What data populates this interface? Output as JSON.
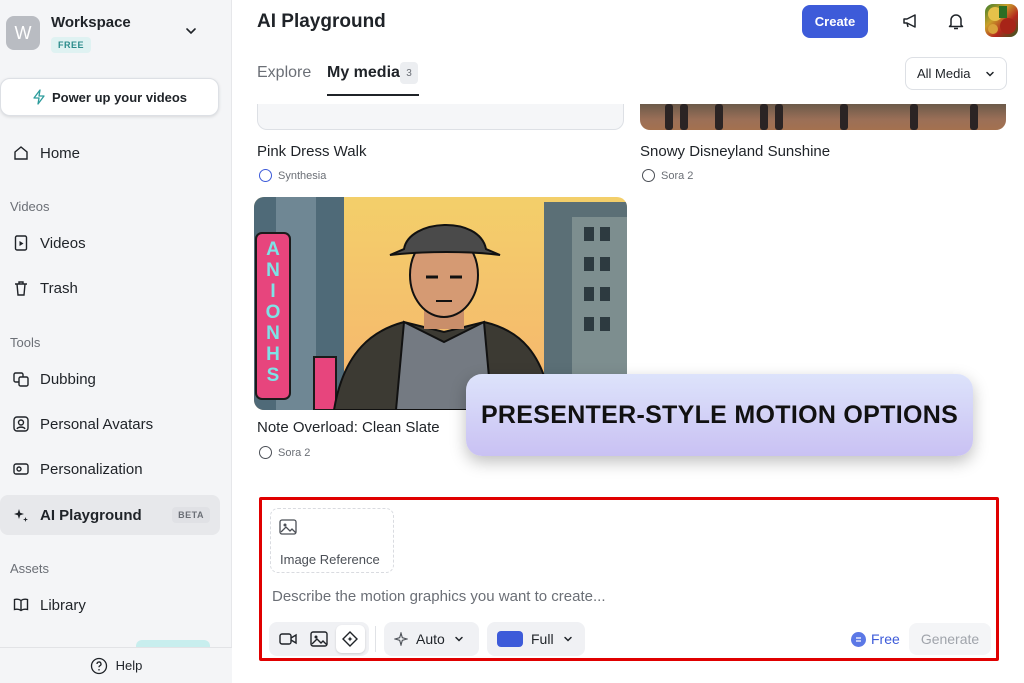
{
  "workspace": {
    "initial": "W",
    "name": "Workspace",
    "plan": "FREE"
  },
  "sidebar": {
    "power_up": "Power up your videos",
    "home": "Home",
    "sections": {
      "videos": "Videos",
      "tools": "Tools",
      "assets": "Assets"
    },
    "items": {
      "videos": "Videos",
      "trash": "Trash",
      "dubbing": "Dubbing",
      "personal_avatars": "Personal Avatars",
      "personalization": "Personalization",
      "ai_playground": "AI Playground",
      "ai_playground_badge": "BETA",
      "library": "Library"
    },
    "help": "Help"
  },
  "header": {
    "title": "AI Playground",
    "create_label": "Create"
  },
  "tabs": [
    {
      "label": "Explore"
    },
    {
      "label": "My media",
      "count": "3",
      "active": true
    }
  ],
  "filter": {
    "selected": "All Media"
  },
  "media": [
    {
      "title": "Pink Dress Walk",
      "source": "Synthesia"
    },
    {
      "title": "Snowy Disneyland Sunshine",
      "source": "Sora 2"
    },
    {
      "title": "Note Overload: Clean Slate",
      "source": "Sora 2",
      "sign_letters": [
        "A",
        "N",
        "I",
        "O",
        "N",
        "H",
        "S"
      ]
    }
  ],
  "overlay_banner": "PRESENTER-STYLE MOTION OPTIONS",
  "composer": {
    "image_reference_label": "Image Reference",
    "prompt_placeholder": "Describe the motion graphics you want to create...",
    "tools": [
      "video-tool",
      "image-tool",
      "motion-graphics-tool"
    ],
    "selected_tool": "motion-graphics-tool",
    "style_option": "Auto",
    "size_option": "Full",
    "credit_label": "Free",
    "generate_label": "Generate"
  },
  "colors": {
    "accent": "#3d5bd9",
    "highlight_border": "#e00000",
    "badge_teal": "#2c8c8c"
  }
}
